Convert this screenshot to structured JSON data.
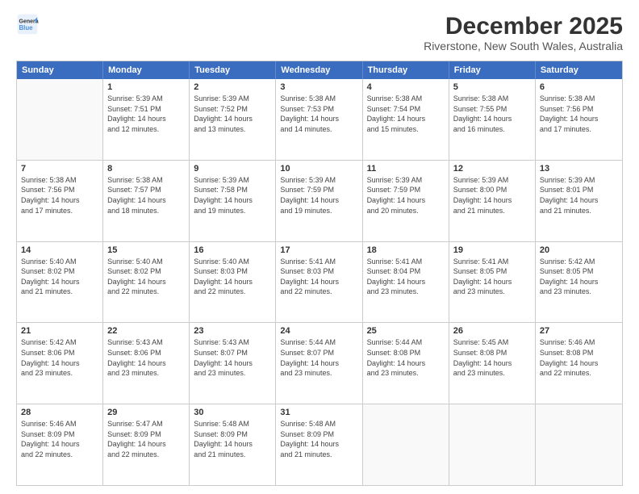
{
  "logo": {
    "line1": "General",
    "line2": "Blue"
  },
  "title": "December 2025",
  "subtitle": "Riverstone, New South Wales, Australia",
  "header_days": [
    "Sunday",
    "Monday",
    "Tuesday",
    "Wednesday",
    "Thursday",
    "Friday",
    "Saturday"
  ],
  "weeks": [
    [
      {
        "day": "",
        "info": ""
      },
      {
        "day": "1",
        "info": "Sunrise: 5:39 AM\nSunset: 7:51 PM\nDaylight: 14 hours\nand 12 minutes."
      },
      {
        "day": "2",
        "info": "Sunrise: 5:39 AM\nSunset: 7:52 PM\nDaylight: 14 hours\nand 13 minutes."
      },
      {
        "day": "3",
        "info": "Sunrise: 5:38 AM\nSunset: 7:53 PM\nDaylight: 14 hours\nand 14 minutes."
      },
      {
        "day": "4",
        "info": "Sunrise: 5:38 AM\nSunset: 7:54 PM\nDaylight: 14 hours\nand 15 minutes."
      },
      {
        "day": "5",
        "info": "Sunrise: 5:38 AM\nSunset: 7:55 PM\nDaylight: 14 hours\nand 16 minutes."
      },
      {
        "day": "6",
        "info": "Sunrise: 5:38 AM\nSunset: 7:56 PM\nDaylight: 14 hours\nand 17 minutes."
      }
    ],
    [
      {
        "day": "7",
        "info": "Sunrise: 5:38 AM\nSunset: 7:56 PM\nDaylight: 14 hours\nand 17 minutes."
      },
      {
        "day": "8",
        "info": "Sunrise: 5:38 AM\nSunset: 7:57 PM\nDaylight: 14 hours\nand 18 minutes."
      },
      {
        "day": "9",
        "info": "Sunrise: 5:39 AM\nSunset: 7:58 PM\nDaylight: 14 hours\nand 19 minutes."
      },
      {
        "day": "10",
        "info": "Sunrise: 5:39 AM\nSunset: 7:59 PM\nDaylight: 14 hours\nand 19 minutes."
      },
      {
        "day": "11",
        "info": "Sunrise: 5:39 AM\nSunset: 7:59 PM\nDaylight: 14 hours\nand 20 minutes."
      },
      {
        "day": "12",
        "info": "Sunrise: 5:39 AM\nSunset: 8:00 PM\nDaylight: 14 hours\nand 21 minutes."
      },
      {
        "day": "13",
        "info": "Sunrise: 5:39 AM\nSunset: 8:01 PM\nDaylight: 14 hours\nand 21 minutes."
      }
    ],
    [
      {
        "day": "14",
        "info": "Sunrise: 5:40 AM\nSunset: 8:02 PM\nDaylight: 14 hours\nand 21 minutes."
      },
      {
        "day": "15",
        "info": "Sunrise: 5:40 AM\nSunset: 8:02 PM\nDaylight: 14 hours\nand 22 minutes."
      },
      {
        "day": "16",
        "info": "Sunrise: 5:40 AM\nSunset: 8:03 PM\nDaylight: 14 hours\nand 22 minutes."
      },
      {
        "day": "17",
        "info": "Sunrise: 5:41 AM\nSunset: 8:03 PM\nDaylight: 14 hours\nand 22 minutes."
      },
      {
        "day": "18",
        "info": "Sunrise: 5:41 AM\nSunset: 8:04 PM\nDaylight: 14 hours\nand 23 minutes."
      },
      {
        "day": "19",
        "info": "Sunrise: 5:41 AM\nSunset: 8:05 PM\nDaylight: 14 hours\nand 23 minutes."
      },
      {
        "day": "20",
        "info": "Sunrise: 5:42 AM\nSunset: 8:05 PM\nDaylight: 14 hours\nand 23 minutes."
      }
    ],
    [
      {
        "day": "21",
        "info": "Sunrise: 5:42 AM\nSunset: 8:06 PM\nDaylight: 14 hours\nand 23 minutes."
      },
      {
        "day": "22",
        "info": "Sunrise: 5:43 AM\nSunset: 8:06 PM\nDaylight: 14 hours\nand 23 minutes."
      },
      {
        "day": "23",
        "info": "Sunrise: 5:43 AM\nSunset: 8:07 PM\nDaylight: 14 hours\nand 23 minutes."
      },
      {
        "day": "24",
        "info": "Sunrise: 5:44 AM\nSunset: 8:07 PM\nDaylight: 14 hours\nand 23 minutes."
      },
      {
        "day": "25",
        "info": "Sunrise: 5:44 AM\nSunset: 8:08 PM\nDaylight: 14 hours\nand 23 minutes."
      },
      {
        "day": "26",
        "info": "Sunrise: 5:45 AM\nSunset: 8:08 PM\nDaylight: 14 hours\nand 23 minutes."
      },
      {
        "day": "27",
        "info": "Sunrise: 5:46 AM\nSunset: 8:08 PM\nDaylight: 14 hours\nand 22 minutes."
      }
    ],
    [
      {
        "day": "28",
        "info": "Sunrise: 5:46 AM\nSunset: 8:09 PM\nDaylight: 14 hours\nand 22 minutes."
      },
      {
        "day": "29",
        "info": "Sunrise: 5:47 AM\nSunset: 8:09 PM\nDaylight: 14 hours\nand 22 minutes."
      },
      {
        "day": "30",
        "info": "Sunrise: 5:48 AM\nSunset: 8:09 PM\nDaylight: 14 hours\nand 21 minutes."
      },
      {
        "day": "31",
        "info": "Sunrise: 5:48 AM\nSunset: 8:09 PM\nDaylight: 14 hours\nand 21 minutes."
      },
      {
        "day": "",
        "info": ""
      },
      {
        "day": "",
        "info": ""
      },
      {
        "day": "",
        "info": ""
      }
    ]
  ]
}
